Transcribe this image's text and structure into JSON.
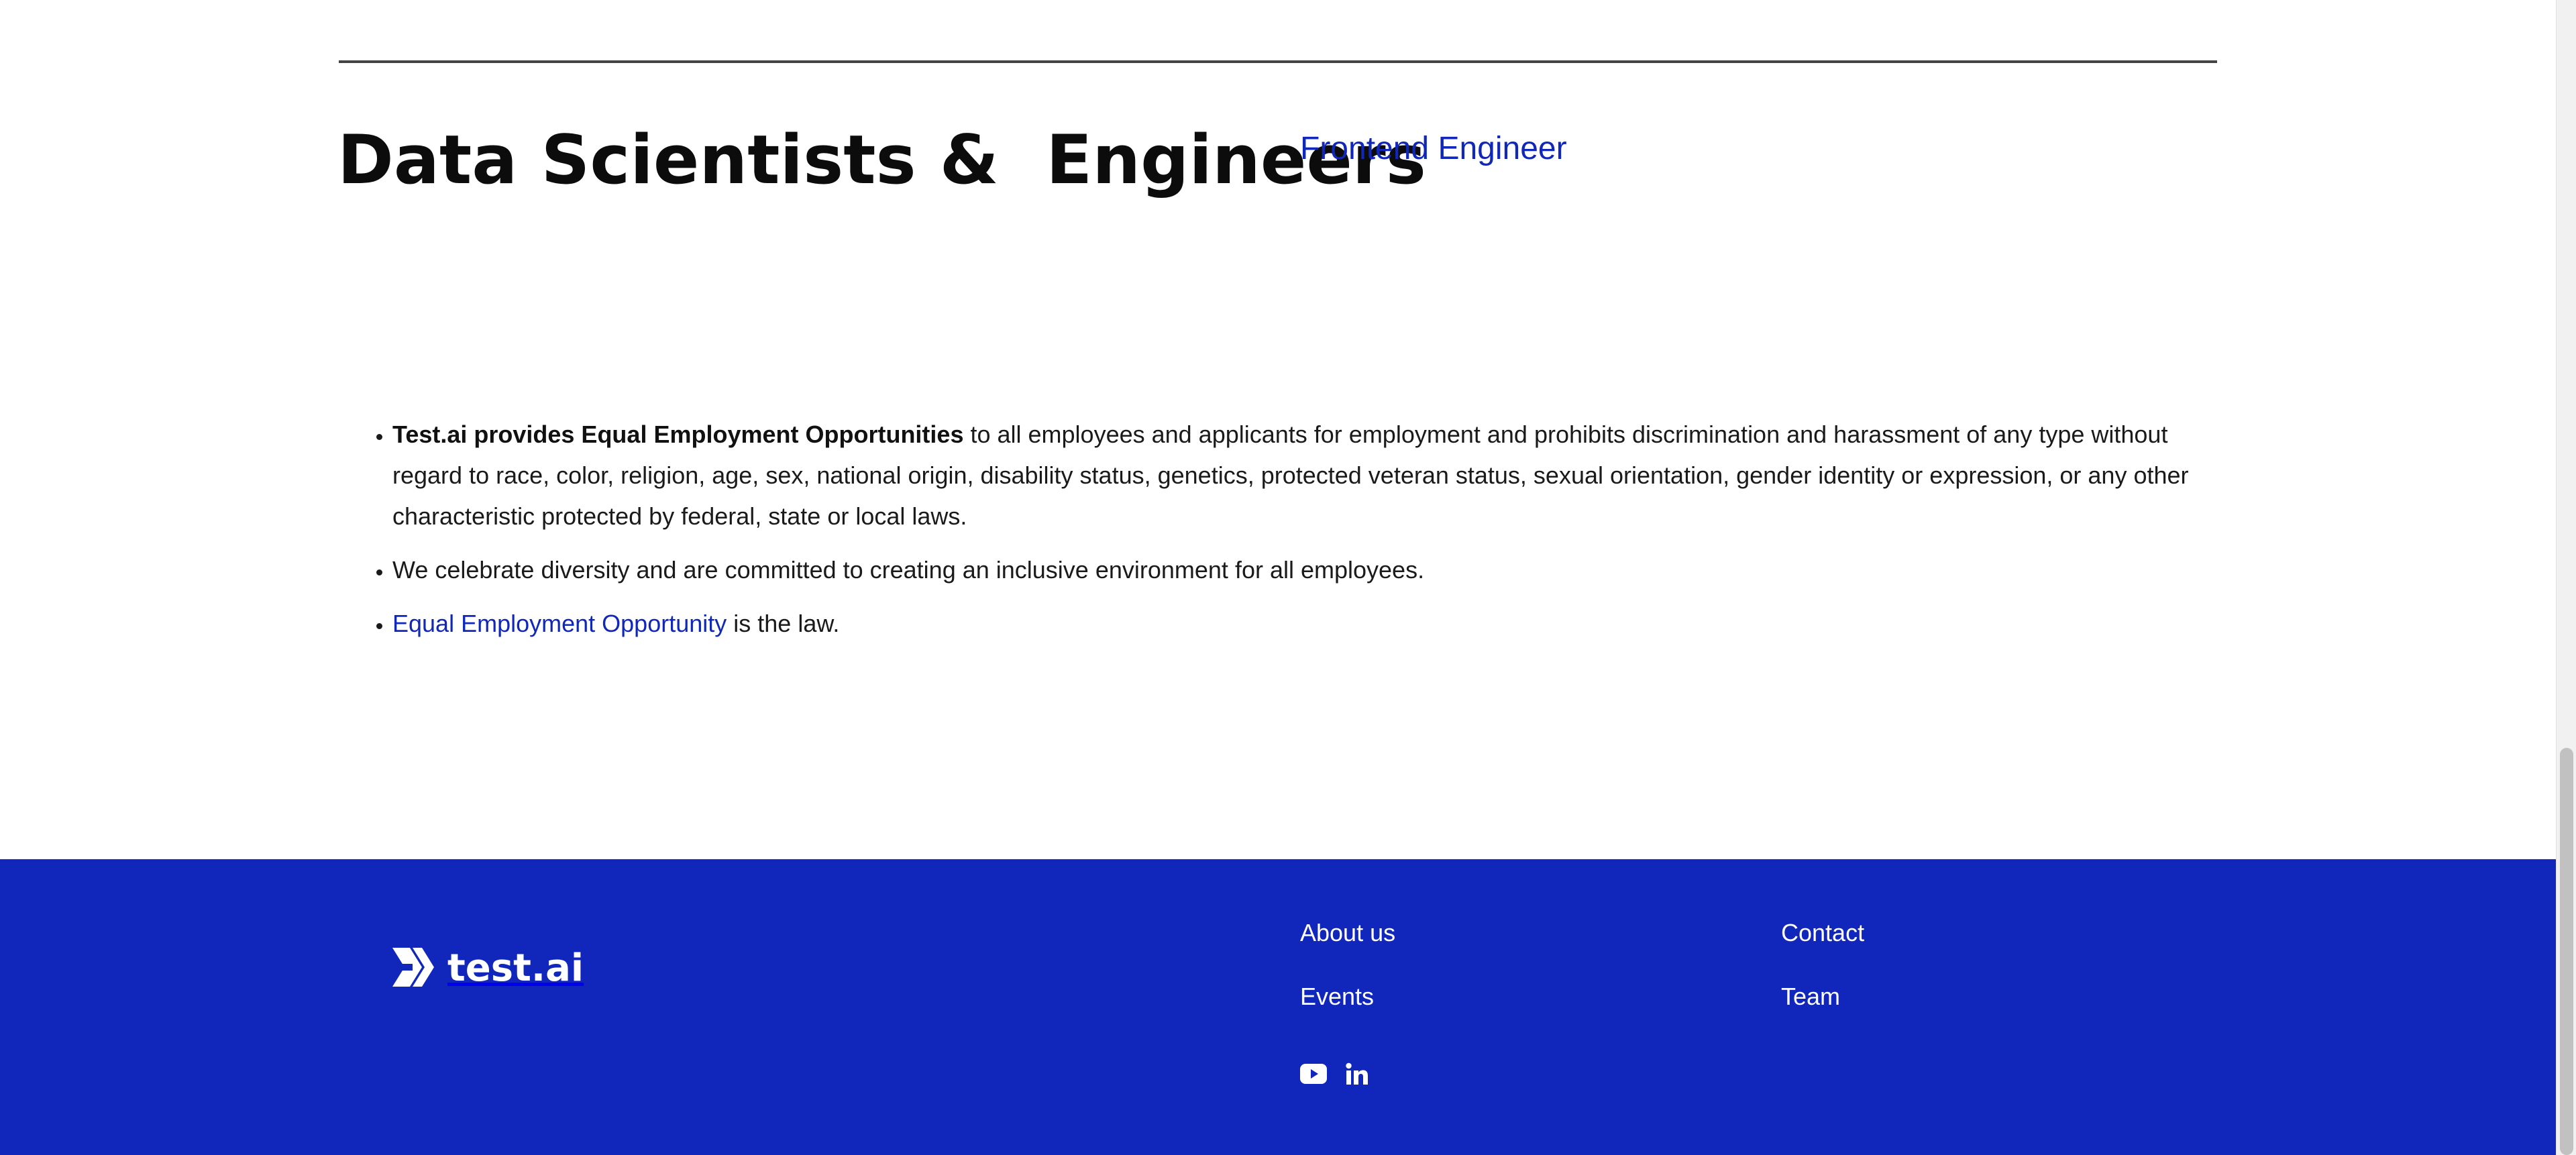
{
  "section": {
    "title": "Data Scientists &  Engineers",
    "job_link": "Frontend Engineer"
  },
  "eeo": {
    "item1_bold": "Test.ai provides Equal Employment Opportunities",
    "item1_rest": " to all employees and applicants for employment and prohibits discrimination and harassment of any type without regard to race, color, religion, age, sex, national origin, disability status, genetics, protected veteran status, sexual orientation, gender identity or expression, or any other characteristic protected by federal, state or local laws.",
    "item2": "We celebrate diversity and are committed to creating an inclusive environment for all employees.",
    "item3_link": "Equal Employment Opportunity",
    "item3_rest": " is the law."
  },
  "footer": {
    "logo_text": "test.ai",
    "links": {
      "about": "About us",
      "events": "Events",
      "contact": "Contact",
      "team": "Team"
    },
    "social_icons": [
      "youtube-icon",
      "linkedin-icon"
    ],
    "background_color": "#1127bb"
  },
  "colors": {
    "link": "#1027b7",
    "footer_bg": "#1127bb",
    "rule": "#444444"
  }
}
